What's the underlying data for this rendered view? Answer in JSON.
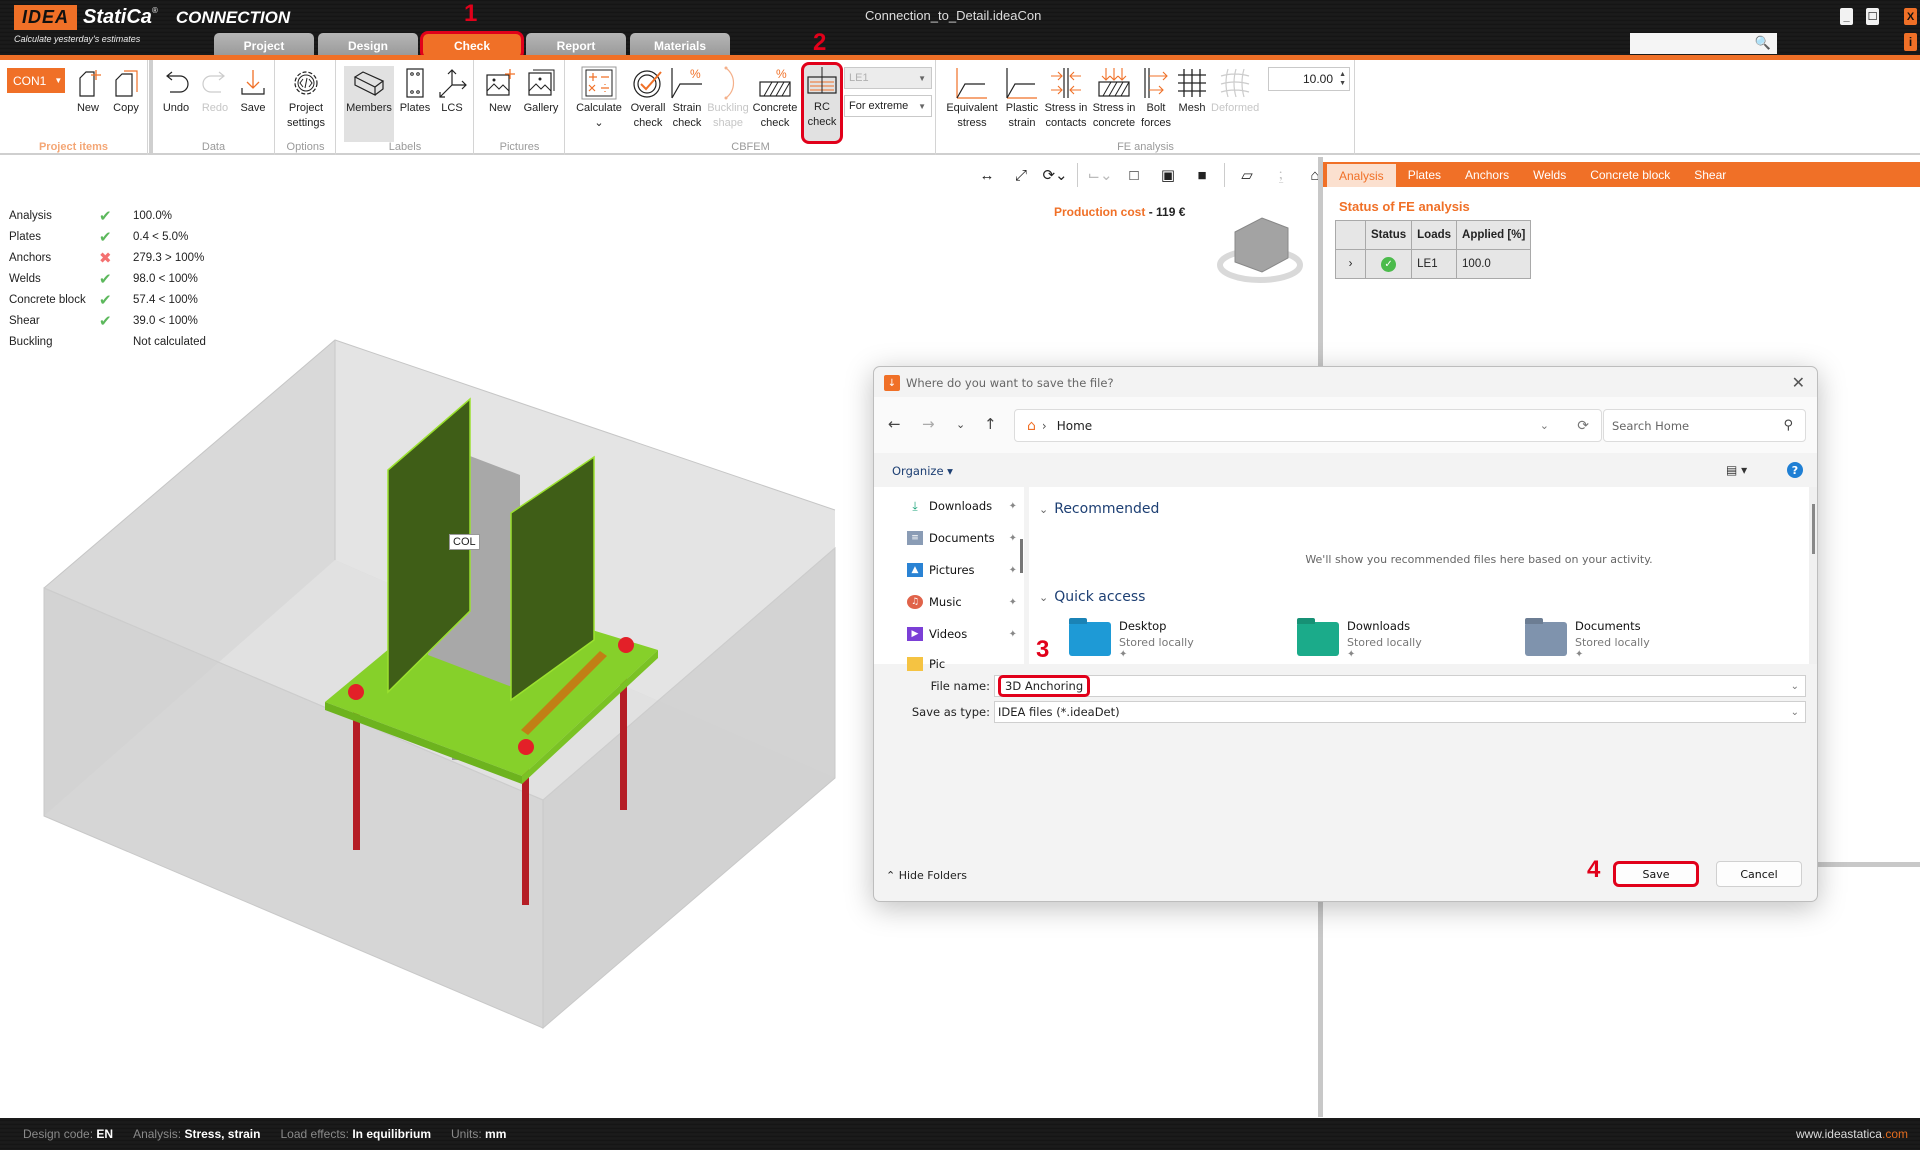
{
  "app": {
    "logo_brand": "IDEA",
    "logo_name": "StatiCa",
    "logo_product": "CONNECTION",
    "tagline": "Calculate yesterday's estimates",
    "window_title": "Connection_to_Detail.ideaCon",
    "colors": {
      "accent": "#f07027",
      "annotation": "#e1001a",
      "ok": "#5cb85c",
      "fail": "#f47171"
    }
  },
  "main_tabs": [
    {
      "label": "Project",
      "active": false
    },
    {
      "label": "Design",
      "active": false
    },
    {
      "label": "Check",
      "active": true
    },
    {
      "label": "Report",
      "active": false
    },
    {
      "label": "Materials",
      "active": false
    }
  ],
  "window_controls": {
    "minimize": "_",
    "maximize": "☐",
    "close": "X",
    "info": "i"
  },
  "annotations": [
    "1",
    "2",
    "3",
    "4"
  ],
  "ribbon": {
    "project_items": {
      "label": "Project items",
      "item": "CON1",
      "new": "New",
      "copy": "Copy"
    },
    "data": {
      "label": "Data",
      "undo": "Undo",
      "redo": "Redo",
      "save": "Save"
    },
    "options": {
      "label": "Options",
      "project_settings_1": "Project",
      "project_settings_2": "settings"
    },
    "labels": {
      "label": "Labels",
      "members": "Members",
      "plates": "Plates",
      "lcs": "LCS"
    },
    "pictures": {
      "label": "Pictures",
      "new": "New",
      "gallery": "Gallery"
    },
    "cbfem": {
      "label": "CBFEM",
      "calculate": "Calculate",
      "overall_1": "Overall",
      "overall_2": "check",
      "strain_1": "Strain",
      "strain_2": "check",
      "buckling_1": "Buckling",
      "buckling_2": "shape",
      "concrete_1": "Concrete",
      "concrete_2": "check",
      "rc_1": "RC",
      "rc_2": "check",
      "load_select": "LE1",
      "extreme_select": "For extreme"
    },
    "fe_analysis": {
      "label": "FE analysis",
      "equiv_1": "Equivalent",
      "equiv_2": "stress",
      "plastic_1": "Plastic",
      "plastic_2": "strain",
      "contacts_1": "Stress in",
      "contacts_2": "contacts",
      "concrete_1": "Stress in",
      "concrete_2": "concrete",
      "bolt_1": "Bolt",
      "bolt_2": "forces",
      "mesh": "Mesh",
      "deformed": "Deformed",
      "scale_value": "10.00"
    }
  },
  "summary": [
    {
      "label": "Analysis",
      "status": "ok",
      "value": "100.0%"
    },
    {
      "label": "Plates",
      "status": "ok",
      "value": "0.4 < 5.0%"
    },
    {
      "label": "Anchors",
      "status": "fail",
      "value": "279.3 > 100%"
    },
    {
      "label": "Welds",
      "status": "ok",
      "value": "98.0 < 100%"
    },
    {
      "label": "Concrete block",
      "status": "ok",
      "value": "57.4 < 100%"
    },
    {
      "label": "Shear",
      "status": "ok",
      "value": "39.0 < 100%"
    },
    {
      "label": "Buckling",
      "status": "none",
      "value": "Not calculated"
    }
  ],
  "status_icons": {
    "ok": "✔",
    "fail": "✖",
    "none": ""
  },
  "production_cost": {
    "label": "Production cost",
    "separator": "-",
    "value": "119 €"
  },
  "model": {
    "member_label": "COL"
  },
  "right_panel": {
    "tabs": [
      "Analysis",
      "Plates",
      "Anchors",
      "Welds",
      "Concrete block",
      "Shear"
    ],
    "active_tab": "Analysis",
    "section_title": "Status of FE analysis",
    "table": {
      "headers": [
        "",
        "Status",
        "Loads",
        "Applied [%]"
      ],
      "rows": [
        {
          "expander": "›",
          "status": "✓",
          "loads": "LE1",
          "applied": "100.0"
        }
      ]
    }
  },
  "status_bar": {
    "design_code_label": "Design code:",
    "design_code": "EN",
    "analysis_label": "Analysis:",
    "analysis": "Stress, strain",
    "load_effects_label": "Load effects:",
    "load_effects": "In equilibrium",
    "units_label": "Units:",
    "units": "mm",
    "url_www": "www.",
    "url_name": "ideastatica",
    "url_tld": ".com"
  },
  "save_dialog": {
    "title": "Where do you want to save the file?",
    "address": "Home",
    "search_placeholder": "Search Home",
    "organize": "Organize ▾",
    "sidebar": [
      {
        "label": "Downloads",
        "icon": "download-icon"
      },
      {
        "label": "Documents",
        "icon": "document-icon"
      },
      {
        "label": "Pictures",
        "icon": "picture-icon"
      },
      {
        "label": "Music",
        "icon": "music-icon"
      },
      {
        "label": "Videos",
        "icon": "video-icon"
      },
      {
        "label": "Pic",
        "icon": "folder-icon"
      }
    ],
    "recommended_heading": "Recommended",
    "recommended_message": "We'll show you recommended files here based on your activity.",
    "quick_access_heading": "Quick access",
    "quick_access": [
      {
        "name": "Desktop",
        "sub": "Stored locally",
        "color": "#1e9ad6"
      },
      {
        "name": "Downloads",
        "sub": "Stored locally",
        "color": "#1bab8a"
      },
      {
        "name": "Documents",
        "sub": "Stored locally",
        "color": "#7f93ad"
      }
    ],
    "file_name_label": "File name:",
    "file_name": "3D Anchoring",
    "save_type_label": "Save as type:",
    "save_type": "IDEA files (*.ideaDet)",
    "hide_folders": "Hide Folders",
    "save_button": "Save",
    "cancel_button": "Cancel"
  }
}
